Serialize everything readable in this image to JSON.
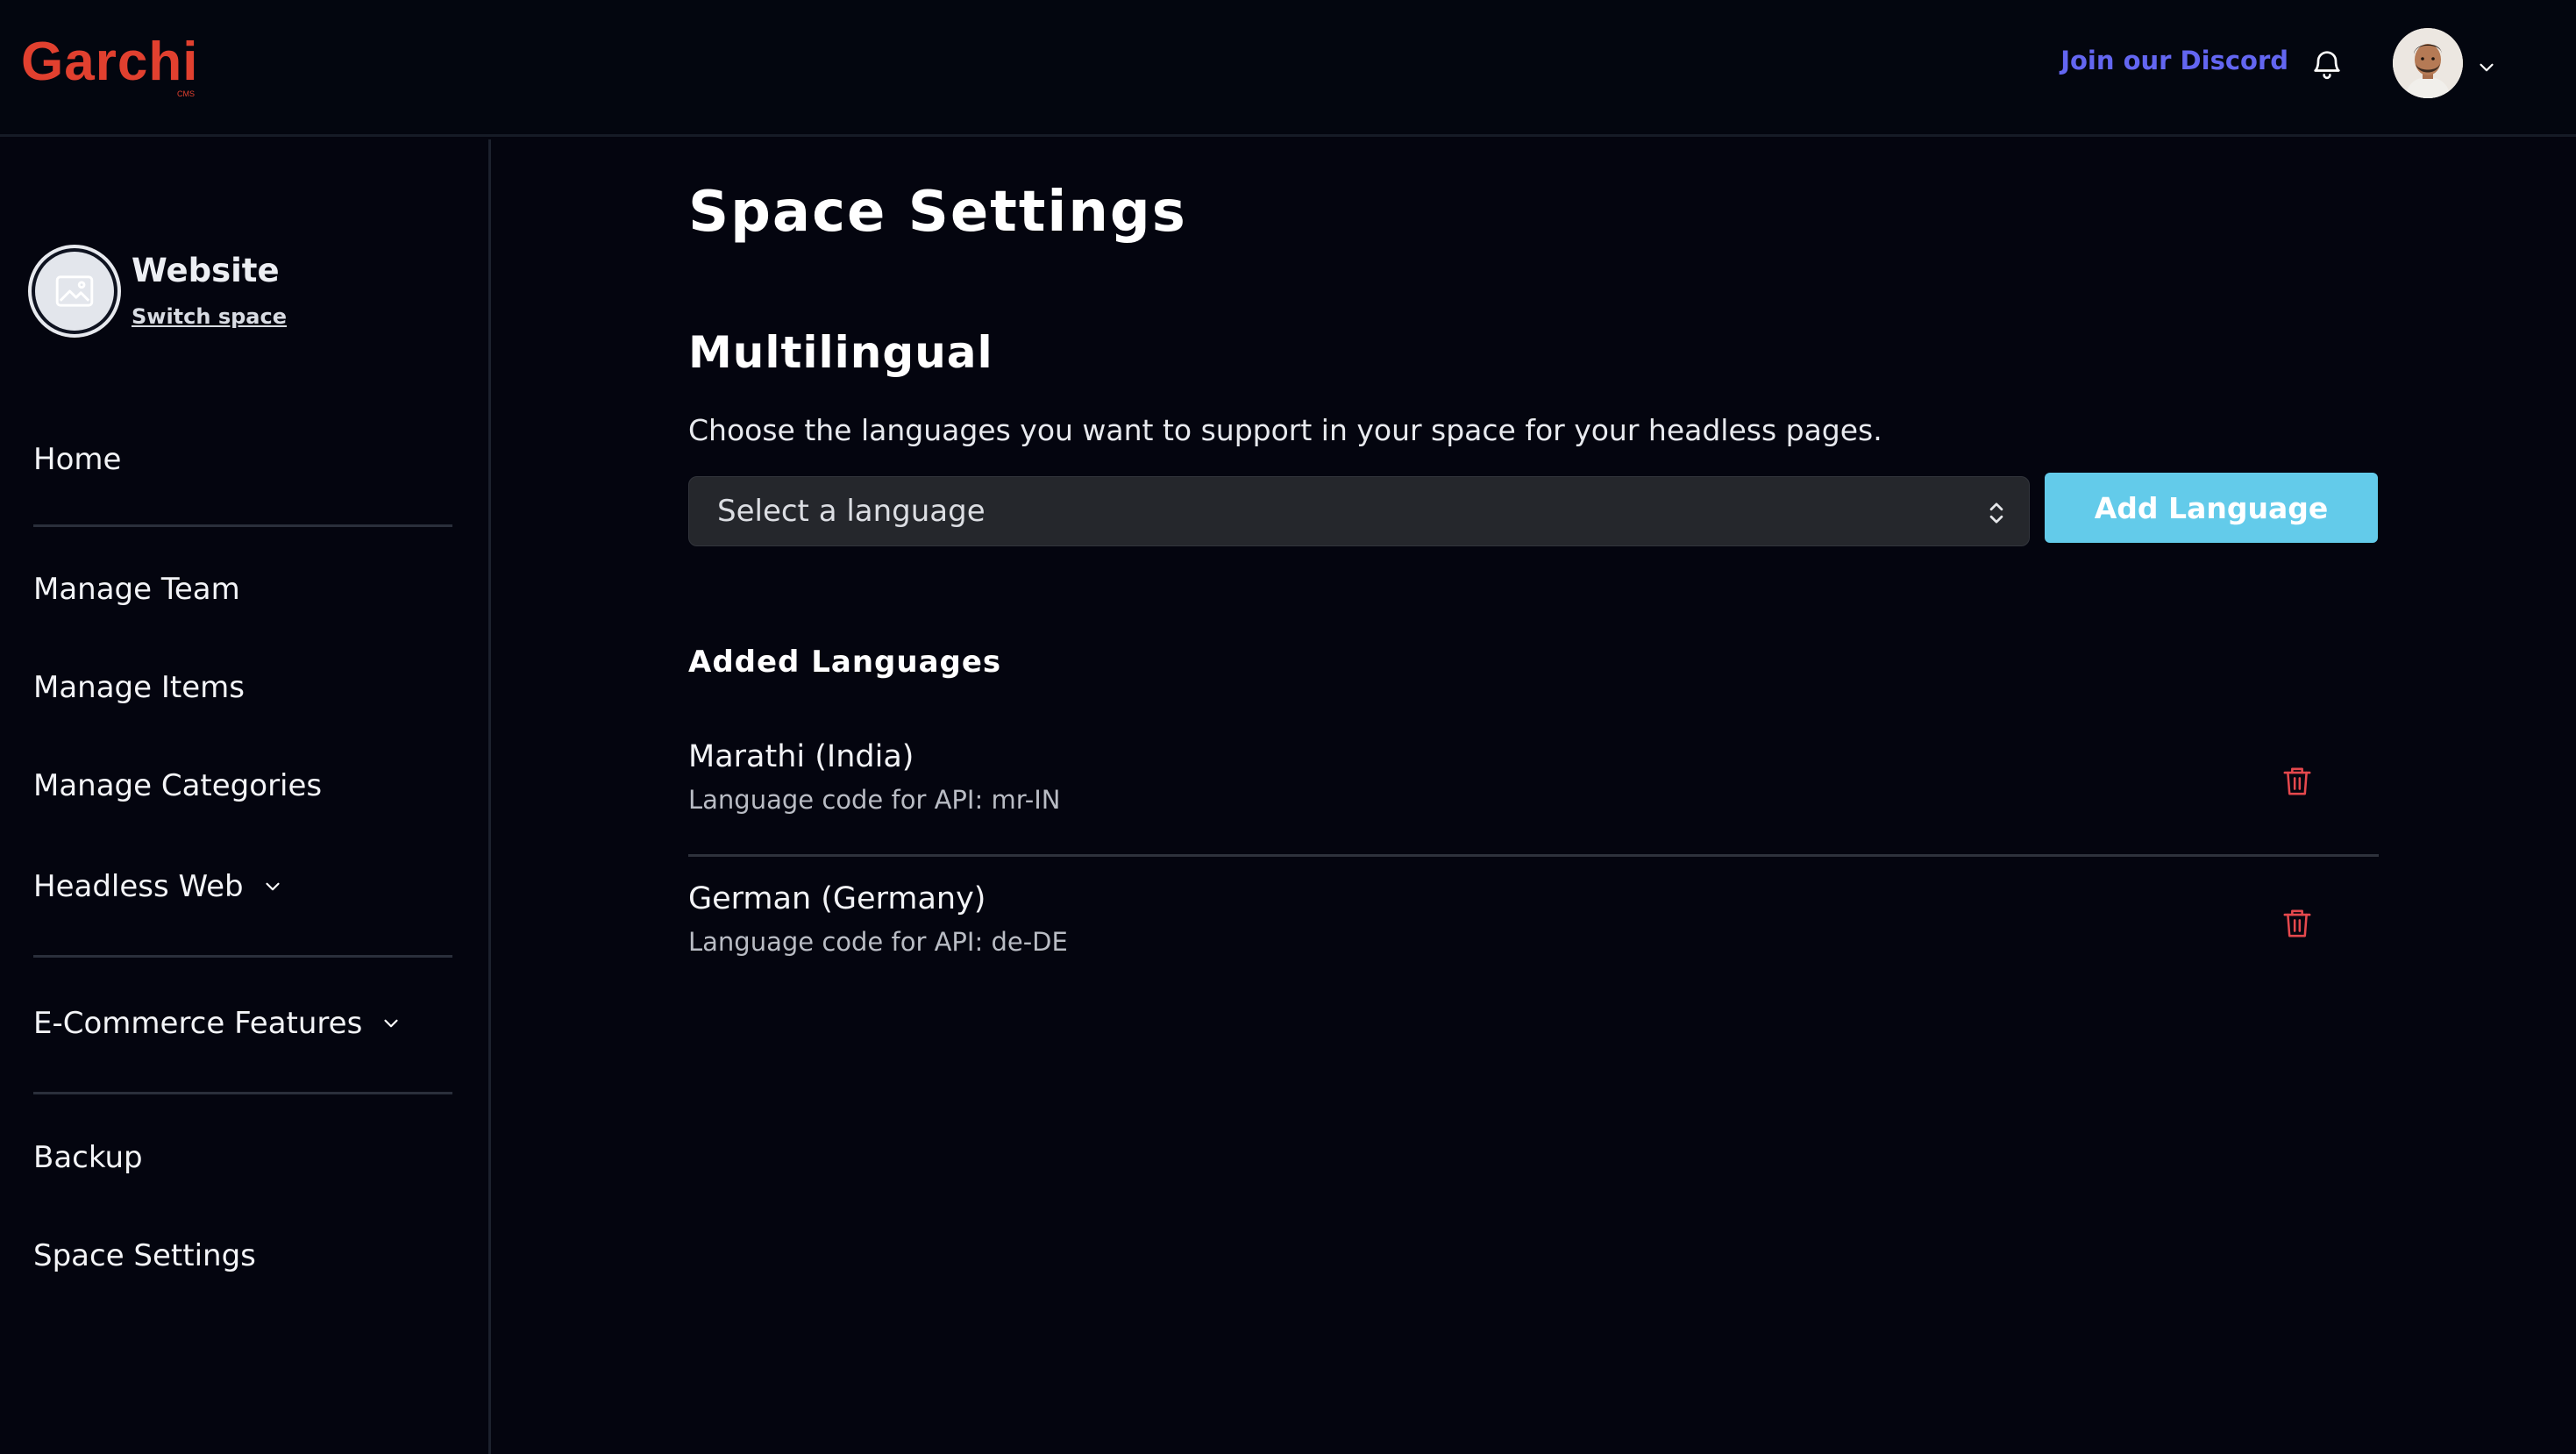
{
  "header": {
    "logo": "Garchi",
    "logo_sub": "CMS",
    "discord_link": "Join our Discord",
    "icons": {
      "bell": "bell-icon",
      "avatar": "user-avatar",
      "caret": "chevron-down-icon"
    }
  },
  "sidebar": {
    "space_name": "Website",
    "switch_space": "Switch space",
    "items": [
      {
        "label": "Home"
      },
      {
        "label": "Manage Team"
      },
      {
        "label": "Manage Items"
      },
      {
        "label": "Manage Categories"
      },
      {
        "label": "Headless Web",
        "expandable": true
      },
      {
        "label": "E-Commerce Features",
        "expandable": true
      },
      {
        "label": "Backup"
      },
      {
        "label": "Space Settings"
      }
    ]
  },
  "main": {
    "title": "Space Settings",
    "section_title": "Multilingual",
    "description": "Choose the languages you want to support in your space for your headless pages.",
    "select_placeholder": "Select a language",
    "add_button": "Add Language",
    "added_title": "Added Languages",
    "languages": [
      {
        "name": "Marathi (India)",
        "code_label": "Language code for API: mr-IN"
      },
      {
        "name": "German (Germany)",
        "code_label": "Language code for API: de-DE"
      }
    ]
  },
  "colors": {
    "background": "#04050f",
    "brand": "#e1402f",
    "discord_link": "#6366f1",
    "primary_button": "#63cbea",
    "delete_icon": "#e5484d"
  }
}
